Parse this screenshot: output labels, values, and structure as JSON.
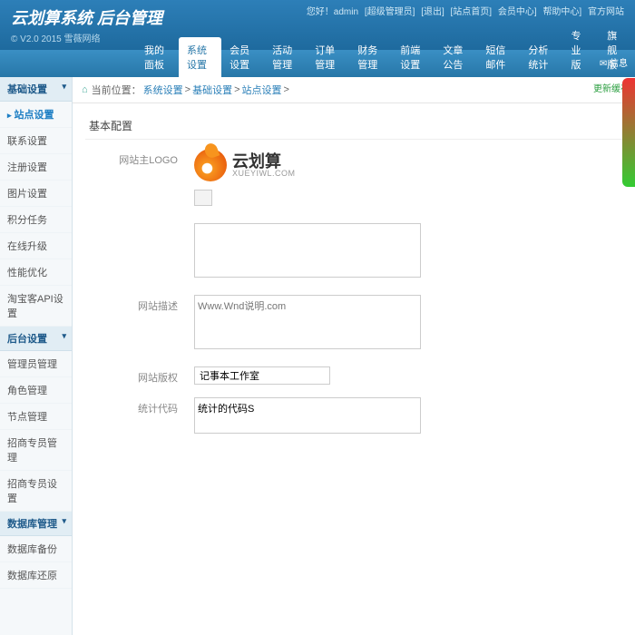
{
  "header": {
    "brand": "云划算系统 后台管理",
    "version": "© V2.0 2015 雪薇网络",
    "toplinks": [
      "您好！admin",
      "[超级管理员]",
      "[退出]",
      "[站点首页]",
      "会员中心]",
      "帮助中心]",
      "官方网站"
    ]
  },
  "nav": {
    "tabs": [
      "我的面板",
      "系统设置",
      "会员设置",
      "活动管理",
      "订单管理",
      "财务管理",
      "前端设置",
      "文章公告",
      "短信邮件",
      "分析统计",
      "专业版",
      "旗舰版"
    ],
    "active": 1,
    "msg": "信息"
  },
  "sidebar": {
    "groups": [
      {
        "title": "基础设置",
        "items": [
          "站点设置",
          "联系设置",
          "注册设置",
          "图片设置",
          "积分任务",
          "在线升级",
          "性能优化",
          "淘宝客API设置"
        ]
      },
      {
        "title": "后台设置",
        "items": [
          "管理员管理",
          "角色管理",
          "节点管理",
          "招商专员管理",
          "招商专员设置"
        ]
      },
      {
        "title": "数据库管理",
        "items": [
          "数据库备份",
          "数据库还原"
        ]
      }
    ],
    "activeItem": "站点设置"
  },
  "crumb": {
    "prefix": "当前位置：",
    "path": [
      "系统设置",
      "基础设置",
      "站点设置"
    ]
  },
  "refresh": "更新缓存",
  "form": {
    "section": "基本配置",
    "rows": {
      "logo_label": "网站主LOGO",
      "desc_label": "网站描述",
      "copyright_label": "网站版权",
      "copyright_value": "记事本工作室",
      "stat_label": "统计代码",
      "stat_value": "统计的代码S",
      "desc_placeholder": "Www.Wnd说明.com"
    },
    "logo": {
      "cn": "云划算",
      "en": "XUEYIWL.COM"
    }
  }
}
